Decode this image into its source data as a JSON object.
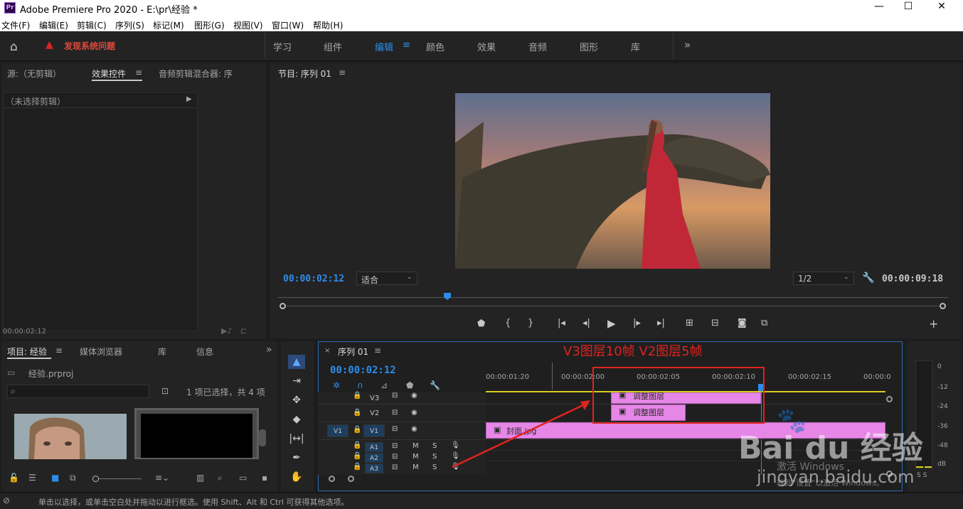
{
  "app": {
    "title": "Adobe Premiere Pro 2020 - E:\\pr\\经验 *",
    "logo": "Pr"
  },
  "menu": [
    "文件(F)",
    "编辑(E)",
    "剪辑(C)",
    "序列(S)",
    "标记(M)",
    "图形(G)",
    "视图(V)",
    "窗口(W)",
    "帮助(H)"
  ],
  "workspace": {
    "alert": "发现系统问题",
    "tabs": [
      "学习",
      "组件",
      "编辑",
      "颜色",
      "效果",
      "音频",
      "图形",
      "库"
    ],
    "active": "编辑",
    "overflow": "»"
  },
  "source_panel": {
    "tabs": [
      "源:（无剪辑）",
      "效果控件",
      "音频剪辑混合器: 序"
    ],
    "no_clip": "（未选择剪辑）",
    "timecode": "00:00:02:12"
  },
  "program_panel": {
    "title": "节目: 序列 01",
    "timecode_left": "00:00:02:12",
    "fit": "适合",
    "resolution": "1/2",
    "timecode_right": "00:00:09:18"
  },
  "project_panel": {
    "tabs": [
      "项目: 经验",
      "媒体浏览器",
      "库",
      "信息"
    ],
    "file": "经验.prproj",
    "selection": "1 项已选择，共 4 项"
  },
  "timeline": {
    "tab": "序列 01",
    "timecode": "00:00:02:12",
    "ruler": [
      "00:00:01:20",
      "00:00:02:00",
      "00:00:02:05",
      "00:00:02:10",
      "00:00:02:15",
      "00:00:0"
    ],
    "tracks_video": [
      "V3",
      "V2",
      "V1"
    ],
    "src_v": "V1",
    "tracks_audio": [
      "A1",
      "A2",
      "A3"
    ],
    "clips": {
      "v3": "调整图层",
      "v2": "调整图层",
      "v1": "封面.jpg"
    }
  },
  "meter": {
    "scale": [
      "0",
      "-12",
      "-24",
      "-36",
      "-48",
      "dB"
    ],
    "solo": "S S"
  },
  "annotation": {
    "text": "V3图层10帧  V2图层5帧",
    "color": "#e0231f"
  },
  "status": "单击以选择，或单击空白处并拖动以进行框选。使用 Shift、Alt 和 Ctrl 可获得其他选项。",
  "watermark": {
    "brand": "Bai du 经验",
    "url": "jingyan.baidu.com",
    "win1": "激活 Windows",
    "win2": "转到\"设置\"以激活 Windows。"
  }
}
